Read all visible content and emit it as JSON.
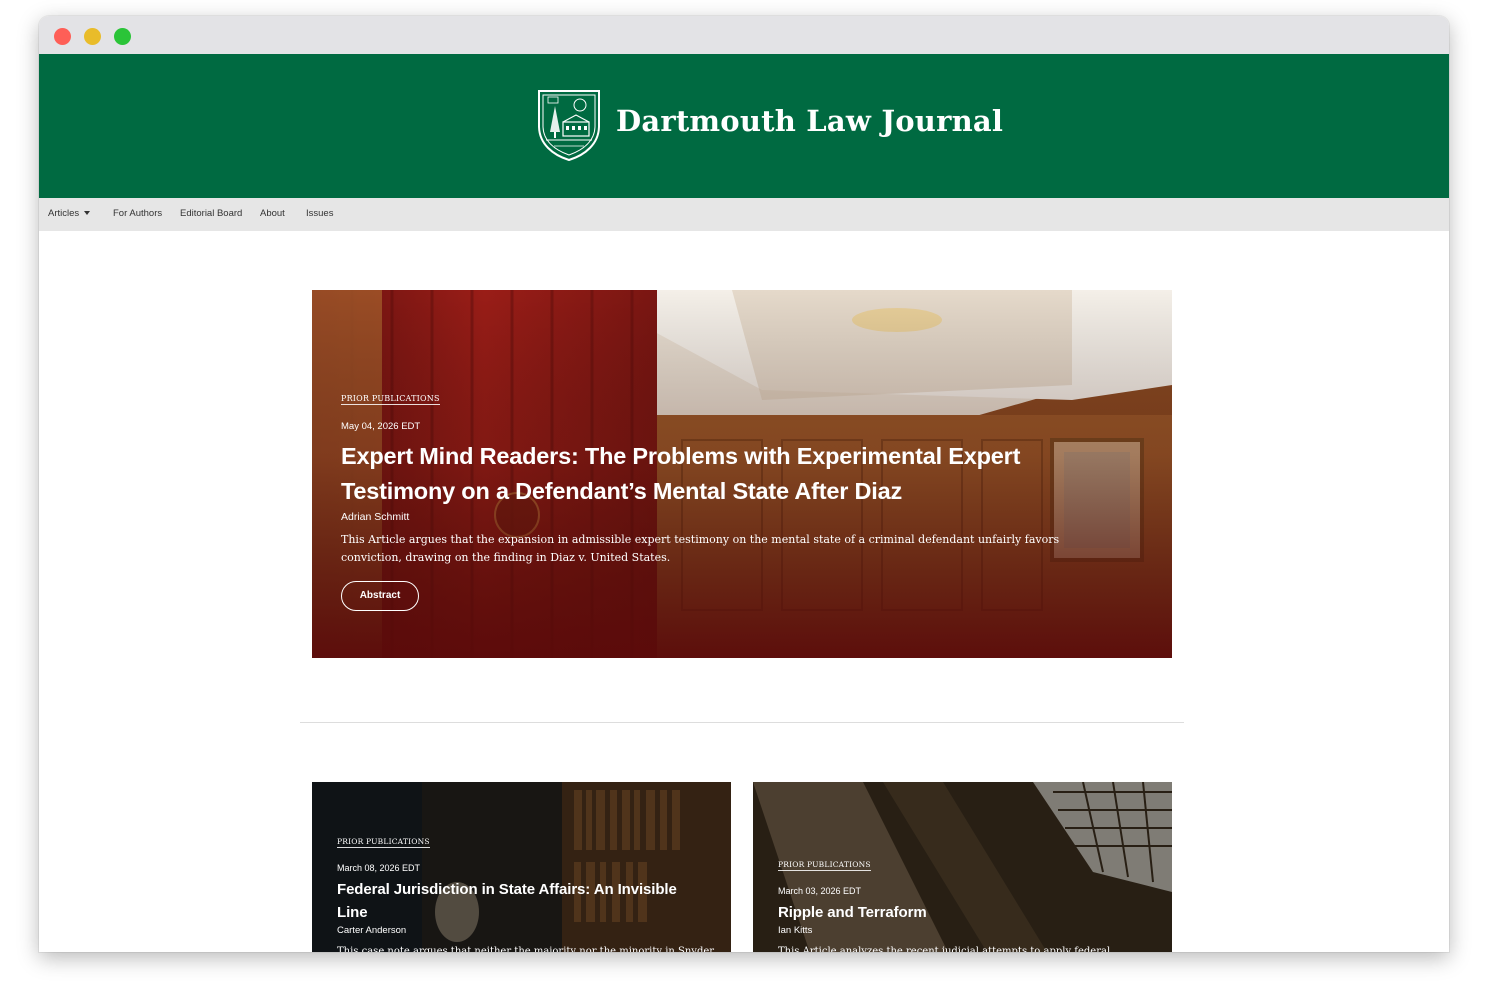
{
  "window": {
    "controls": [
      "close",
      "minimize",
      "maximize"
    ]
  },
  "masthead": {
    "title": "Dartmouth Law Journal",
    "crest_icon": "dartmouth-shield-icon",
    "background": "#006a41"
  },
  "nav": {
    "items": [
      {
        "label": "Articles",
        "has_dropdown": true
      },
      {
        "label": "For Authors"
      },
      {
        "label": "Editorial Board"
      },
      {
        "label": "About"
      },
      {
        "label": "Issues"
      }
    ]
  },
  "featured": {
    "category": "PRIOR PUBLICATIONS",
    "date": "May 04, 2026 EDT",
    "title": "Expert Mind Readers: The Problems with Experimental Expert Testimony on a Defendant’s Mental State After Diaz",
    "author": "Adrian Schmitt",
    "summary": "This Article argues that the expansion in admissible expert testimony on the mental state of a criminal defendant unfairly favors conviction, drawing on the finding in Diaz v. United States.",
    "button_label": "Abstract"
  },
  "articles": [
    {
      "category": "PRIOR PUBLICATIONS",
      "date": "March 08, 2026 EDT",
      "title": "Federal Jurisdiction in State Affairs: An Invisible Line",
      "author": "Carter Anderson",
      "summary": "This case note argues that neither the majority nor the minority in Snyder"
    },
    {
      "category": "PRIOR PUBLICATIONS",
      "date": "March 03, 2026 EDT",
      "title": "Ripple and Terraform",
      "author": "Ian Kitts",
      "summary": "This Article analyzes the recent judicial attempts to apply federal"
    }
  ]
}
